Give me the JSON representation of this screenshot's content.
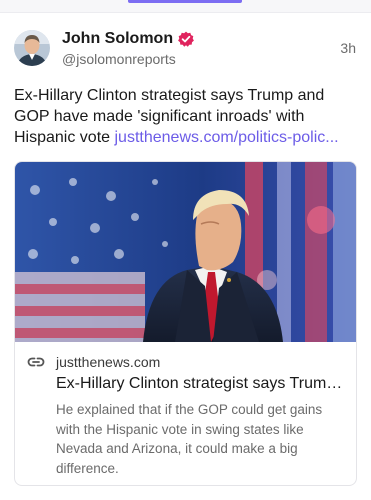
{
  "post": {
    "author_name": "John Solomon",
    "author_handle": "@jsolomonreports",
    "timestamp": "3h",
    "text": "Ex-Hillary Clinton strategist says Trump and GOP have made 'significant inroads' with Hispanic vote ",
    "link_text": "justthenews.com/politics-polic..."
  },
  "card": {
    "domain": "justthenews.com",
    "title": "Ex-Hillary Clinton strategist says Trump and GOP have made 'significant inroads' with Hispanic vote",
    "description": "He explained that if the GOP could get gains with the Hispanic vote in swing states like Nevada and Arizona, it could make a big difference."
  },
  "colors": {
    "accent": "#7c6df2",
    "link": "#6c5ce7",
    "verified_badge": "#e0245e"
  },
  "icons": {
    "verified": "verified-badge-icon",
    "link": "link-icon"
  }
}
